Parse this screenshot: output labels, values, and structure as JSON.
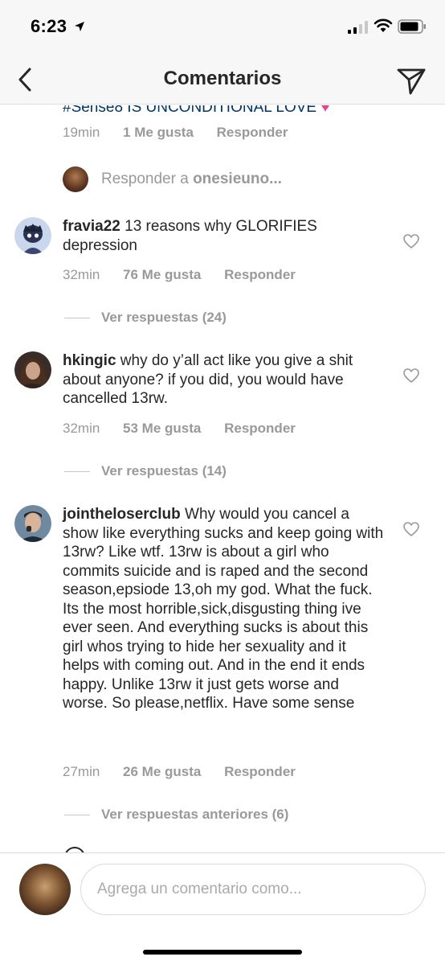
{
  "status": {
    "time": "6:23"
  },
  "nav": {
    "title": "Comentarios"
  },
  "clipped_comment": {
    "text": "#Sense8 IS UNCONDITIONAL LOVE",
    "time": "19min",
    "likes": "1 Me gusta",
    "reply": "Responder"
  },
  "reply_prompt": {
    "prefix": "Responder a ",
    "user": "onesieuno..."
  },
  "comments": [
    {
      "user": "fravia22",
      "text": "13 reasons why GLORIFIES depression",
      "time": "32min",
      "likes": "76 Me gusta",
      "reply": "Responder",
      "view_replies": "Ver respuestas (24)"
    },
    {
      "user": "hkingic",
      "text": "why do y’all act like you give a shit about anyone? if you did, you would have cancelled 13rw.",
      "time": "32min",
      "likes": "53 Me gusta",
      "reply": "Responder",
      "view_replies": "Ver respuestas (14)"
    },
    {
      "user": "jointheloserclub",
      "text": "Why would you cancel a show like everything sucks and keep going with 13rw? Like wtf. 13rw is about a girl who commits suicide and is raped and the second season,epsiode 13,oh my god. What the fuck. Its the most horrible,sick,disgusting thing ive ever seen. And everything sucks is about this girl whos trying to hide her sexuality and it helps with coming out. And in the end it ends happy. Unlike 13rw it just gets worse and worse. So please,netflix. Have some sense",
      "time": "27min",
      "likes": "26 Me gusta",
      "reply": "Responder",
      "view_replies": "Ver respuestas anteriores (6)"
    }
  ],
  "composer": {
    "placeholder": "Agrega un comentario como..."
  },
  "colors": {
    "link": "#003569",
    "muted": "#999999",
    "text": "#262626",
    "emoji_heart": "#e84393"
  }
}
